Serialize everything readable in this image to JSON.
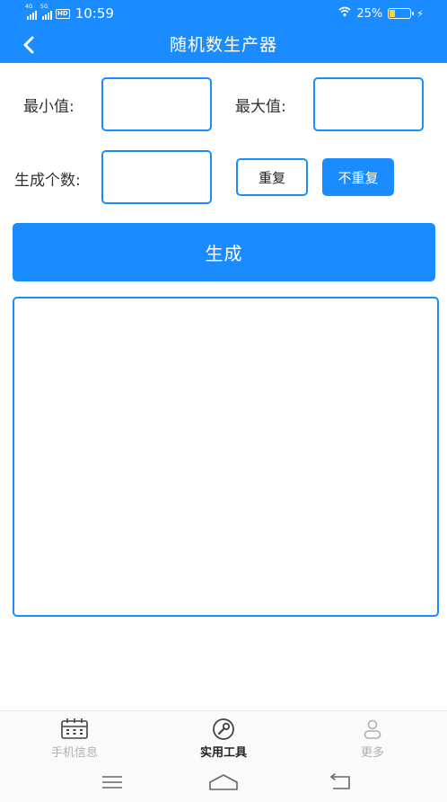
{
  "status_bar": {
    "network_1": "4G",
    "network_2": "5G",
    "hd_badge": "HD",
    "time": "10:59",
    "battery_text": "25%",
    "battery_level_percent": 25
  },
  "header": {
    "title": "随机数生产器"
  },
  "form": {
    "min_label": "最小值:",
    "max_label": "最大值:",
    "count_label": "生成个数:",
    "min_value": "",
    "max_value": "",
    "count_value": "",
    "repeat_label": "重复",
    "no_repeat_label": "不重复"
  },
  "generate_button": "生成",
  "result": "",
  "bottom_nav": {
    "items": [
      {
        "label": "手机信息",
        "icon": "calendar-icon",
        "active": false
      },
      {
        "label": "实用工具",
        "icon": "wrench-icon",
        "active": true
      },
      {
        "label": "更多",
        "icon": "person-icon",
        "active": false
      }
    ]
  },
  "colors": {
    "primary": "#1a8cff",
    "battery_fill": "#ffd23c",
    "inactive": "#b0b0b0"
  }
}
